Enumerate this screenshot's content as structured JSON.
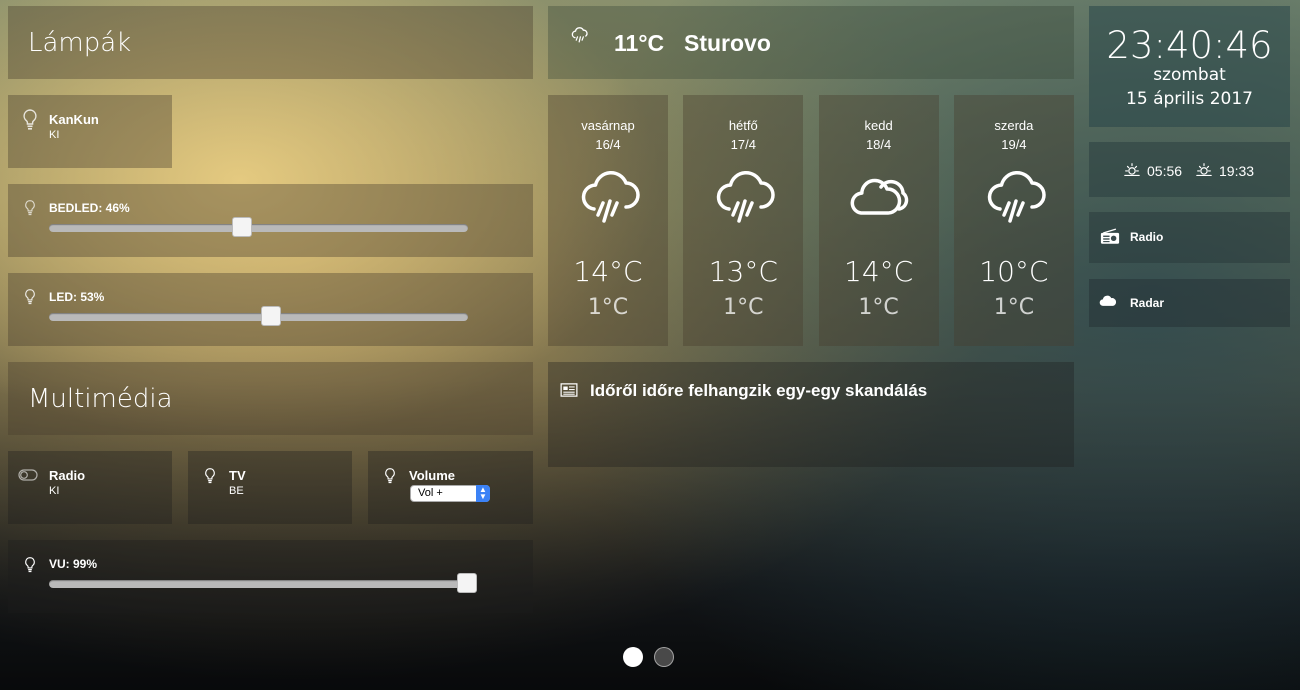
{
  "lamps": {
    "title": "Lámpák",
    "kankun": {
      "name": "KanKun",
      "state": "KI"
    },
    "bedled": {
      "label": "BEDLED: 46%",
      "level": 0.46
    },
    "led": {
      "label": "LED: 53%",
      "level": 0.53
    }
  },
  "multimedia": {
    "title": "Multimédia",
    "radio": {
      "name": "Radio",
      "state": "KI"
    },
    "tv": {
      "name": "TV",
      "state": "BE"
    },
    "volume": {
      "name": "Volume",
      "selected": "Vol +"
    },
    "vu": {
      "label": "VU: 99%",
      "level": 0.99
    }
  },
  "weather": {
    "current_temp": "11°C",
    "city": "Sturovo",
    "current_icon": "rain-cloud-icon",
    "forecast": [
      {
        "day": "vasárnap",
        "date": "16/4",
        "high": "14°C",
        "low": "1°C",
        "icon": "rain-icon"
      },
      {
        "day": "hétfő",
        "date": "17/4",
        "high": "13°C",
        "low": "1°C",
        "icon": "rain-icon"
      },
      {
        "day": "kedd",
        "date": "18/4",
        "high": "14°C",
        "low": "1°C",
        "icon": "cloudy-icon"
      },
      {
        "day": "szerda",
        "date": "19/4",
        "high": "10°C",
        "low": "1°C",
        "icon": "rain-icon"
      }
    ]
  },
  "news": {
    "headline": "Időről időre felhangzik egy-egy skandálás"
  },
  "clock": {
    "time": "23:40:46",
    "weekday": "szombat",
    "date": "15 április 2017"
  },
  "sun": {
    "sunrise": "05:56",
    "sunset": "19:33"
  },
  "links": {
    "radio": "Radio",
    "radar": "Radar"
  },
  "pager": {
    "pages": 2,
    "active": 1
  },
  "colors": {
    "accent": "#3b82f6",
    "slider_track": "#b9b9b9",
    "text": "#ffffff"
  }
}
